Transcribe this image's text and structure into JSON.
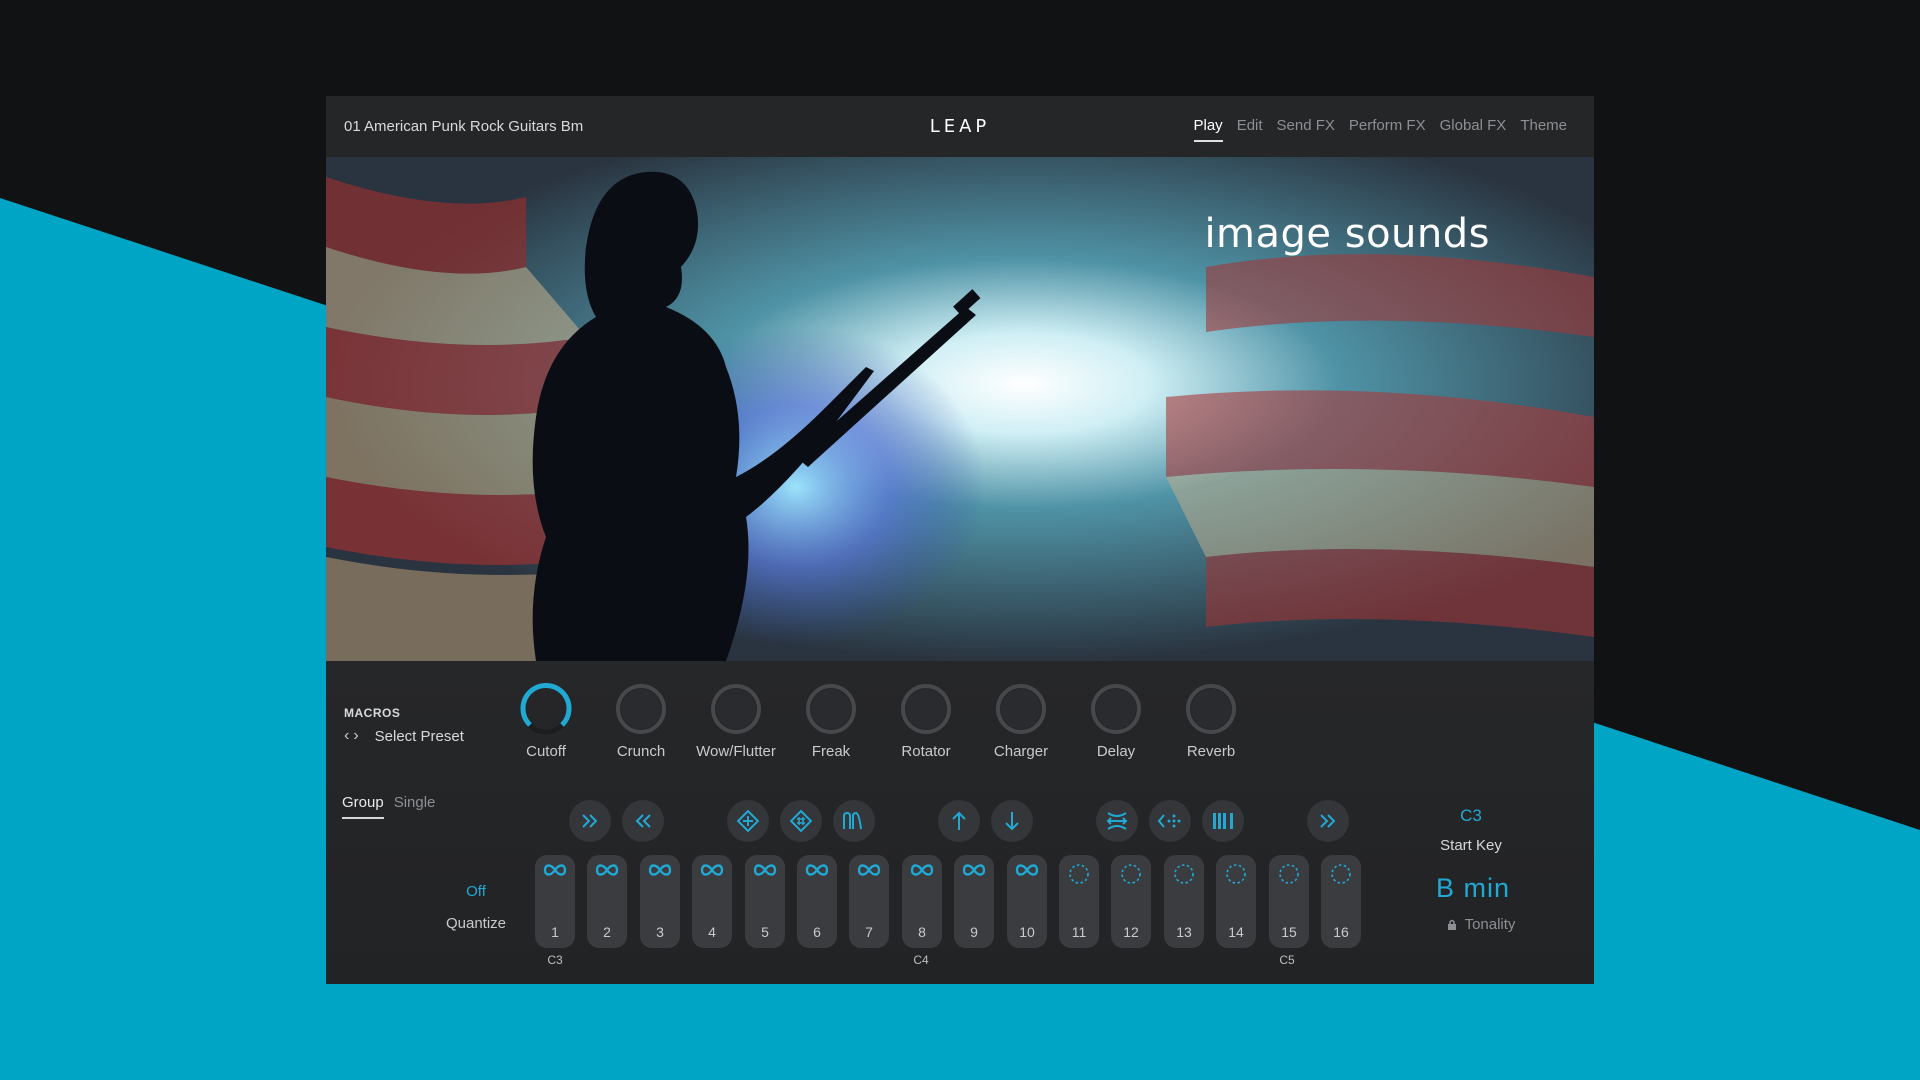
{
  "header": {
    "preset_name": "01 American Punk Rock Guitars Bm",
    "logo_text": "LEAP"
  },
  "nav": [
    {
      "label": "Play",
      "active": true
    },
    {
      "label": "Edit",
      "active": false
    },
    {
      "label": "Send FX",
      "active": false
    },
    {
      "label": "Perform FX",
      "active": false
    },
    {
      "label": "Global FX",
      "active": false
    },
    {
      "label": "Theme",
      "active": false
    }
  ],
  "hero": {
    "brand": "image sounds"
  },
  "macros": {
    "title": "MACROS",
    "select_preset": "Select Preset",
    "knobs": [
      {
        "label": "Cutoff",
        "value": 0.95
      },
      {
        "label": "Crunch",
        "value": 0
      },
      {
        "label": "Wow/Flutter",
        "value": 0
      },
      {
        "label": "Freak",
        "value": 0
      },
      {
        "label": "Rotator",
        "value": 0
      },
      {
        "label": "Charger",
        "value": 0
      },
      {
        "label": "Delay",
        "value": 0
      },
      {
        "label": "Reverb",
        "value": 0
      }
    ]
  },
  "modes": {
    "group": "Group",
    "single": "Single",
    "active": "Group"
  },
  "tools": [
    "fast-forward-icon",
    "rewind-icon",
    "grid-diamond-icon",
    "grid-diamond-dense-icon",
    "envelope-icon",
    "arrow-up-icon",
    "arrow-down-icon",
    "filter-icon",
    "scatter-icon",
    "slice-icon",
    "skip-forward-icon"
  ],
  "quantize": {
    "value": "Off",
    "label": "Quantize"
  },
  "pads": [
    "1",
    "2",
    "3",
    "4",
    "5",
    "6",
    "7",
    "8",
    "9",
    "10",
    "11",
    "12",
    "13",
    "14",
    "15",
    "16"
  ],
  "pad_loops": [
    true,
    true,
    true,
    true,
    true,
    true,
    true,
    true,
    true,
    true,
    false,
    false,
    false,
    false,
    false,
    false
  ],
  "key_labels": {
    "c3": "C3",
    "c4": "C4",
    "c5": "C5"
  },
  "start_key": {
    "value": "C3",
    "label": "Start Key"
  },
  "tonality": {
    "value": "B  min",
    "label": "Tonality"
  },
  "colors": {
    "accent": "#21a9d4",
    "background_blue": "#00a5c6",
    "panel": "#242528"
  }
}
